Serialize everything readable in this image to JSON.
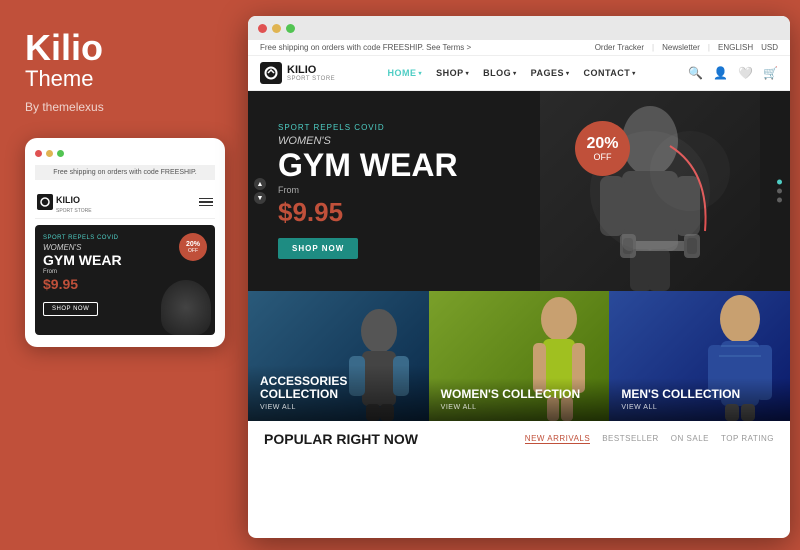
{
  "brand": {
    "name": "Kilio",
    "subtitle": "Theme",
    "author": "By themelexus"
  },
  "mobile": {
    "banner_text": "Free shipping on orders with code FREESHIP.",
    "logo_name": "KILIO",
    "logo_tagline": "SPORT STORE",
    "hero": {
      "eyebrow": "SPORT REPELS COVID",
      "title_line1": "WOMEN'S",
      "title_line2": "GYM WEAR",
      "from_label": "From",
      "price": "$9.95",
      "badge_pct": "20%",
      "badge_off": "OFF",
      "shop_btn": "SHOP NOW"
    }
  },
  "desktop": {
    "topbar": {
      "left": "Free shipping on orders with code FREESHIP. See Terms  >",
      "order_tracker": "Order Tracker",
      "newsletter": "Newsletter",
      "language": "ENGLISH",
      "currency": "USD"
    },
    "nav": {
      "logo_name": "KILIO",
      "logo_tagline": "SPORT STORE",
      "items": [
        {
          "label": "HOME",
          "active": true,
          "has_caret": true
        },
        {
          "label": "SHOP",
          "active": false,
          "has_caret": true
        },
        {
          "label": "BLOG",
          "active": false,
          "has_caret": true
        },
        {
          "label": "PAGES",
          "active": false,
          "has_caret": true
        },
        {
          "label": "CONTACT",
          "active": false,
          "has_caret": true
        }
      ]
    },
    "hero": {
      "eyebrow": "SPORT REPELS COVID",
      "title_women": "WOMEN'S",
      "title_gym": "GYM WEAR",
      "from_label": "From",
      "price": "$9.95",
      "badge_pct": "20%",
      "badge_off": "OFF",
      "shop_btn": "SHOP NOW"
    },
    "collections": [
      {
        "title": "ACCESSORIES\nCOLLECTION",
        "view_all": "VIEW ALL",
        "color_start": "#3a6b8a",
        "color_end": "#1a3a5a"
      },
      {
        "title": "WOMEN'S\nCOLLECTION",
        "view_all": "VIEW ALL",
        "color_start": "#8ab03a",
        "color_end": "#5a8020"
      },
      {
        "title": "MEN'S\nCOLLECTION",
        "view_all": "VIEW ALL",
        "color_start": "#3a5a9a",
        "color_end": "#1a2a6a"
      }
    ],
    "popular": {
      "title": "POPULAR RIGHT NOW",
      "tabs": [
        "NEW ARRIVALS",
        "BESTSELLER",
        "ON SALE",
        "TOP RATING"
      ]
    }
  },
  "dots": {
    "title_bar": [
      "red",
      "yellow",
      "green"
    ],
    "mobile_title": [
      "red",
      "yellow",
      "green"
    ]
  }
}
